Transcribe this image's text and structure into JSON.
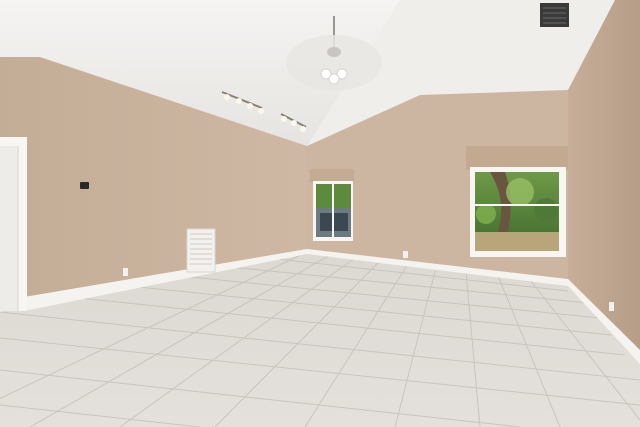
{
  "scene": {
    "description_hidden": "",
    "colors": {
      "ceiling": "#f1f0ee",
      "ceiling_shadow": "#e3e1de",
      "wall_left": "#c9b29c",
      "wall_left_dark": "#b39b85",
      "wall_back": "#cdb7a2",
      "wall_right": "#bea58f",
      "baseboard": "#f4f2ef",
      "floor": "#d7d3cd",
      "floor_light": "#e6e3de",
      "grout": "#c2bdb6",
      "window_frame": "#f7f6f3",
      "foliage": "#4f7d3a",
      "foliage_light": "#8fb35c",
      "door": "#f4f3f0"
    },
    "icons": [
      "ceiling-fan-icon",
      "track-light-icon",
      "air-vent-icon",
      "thermostat-icon",
      "outlet-icon"
    ]
  }
}
